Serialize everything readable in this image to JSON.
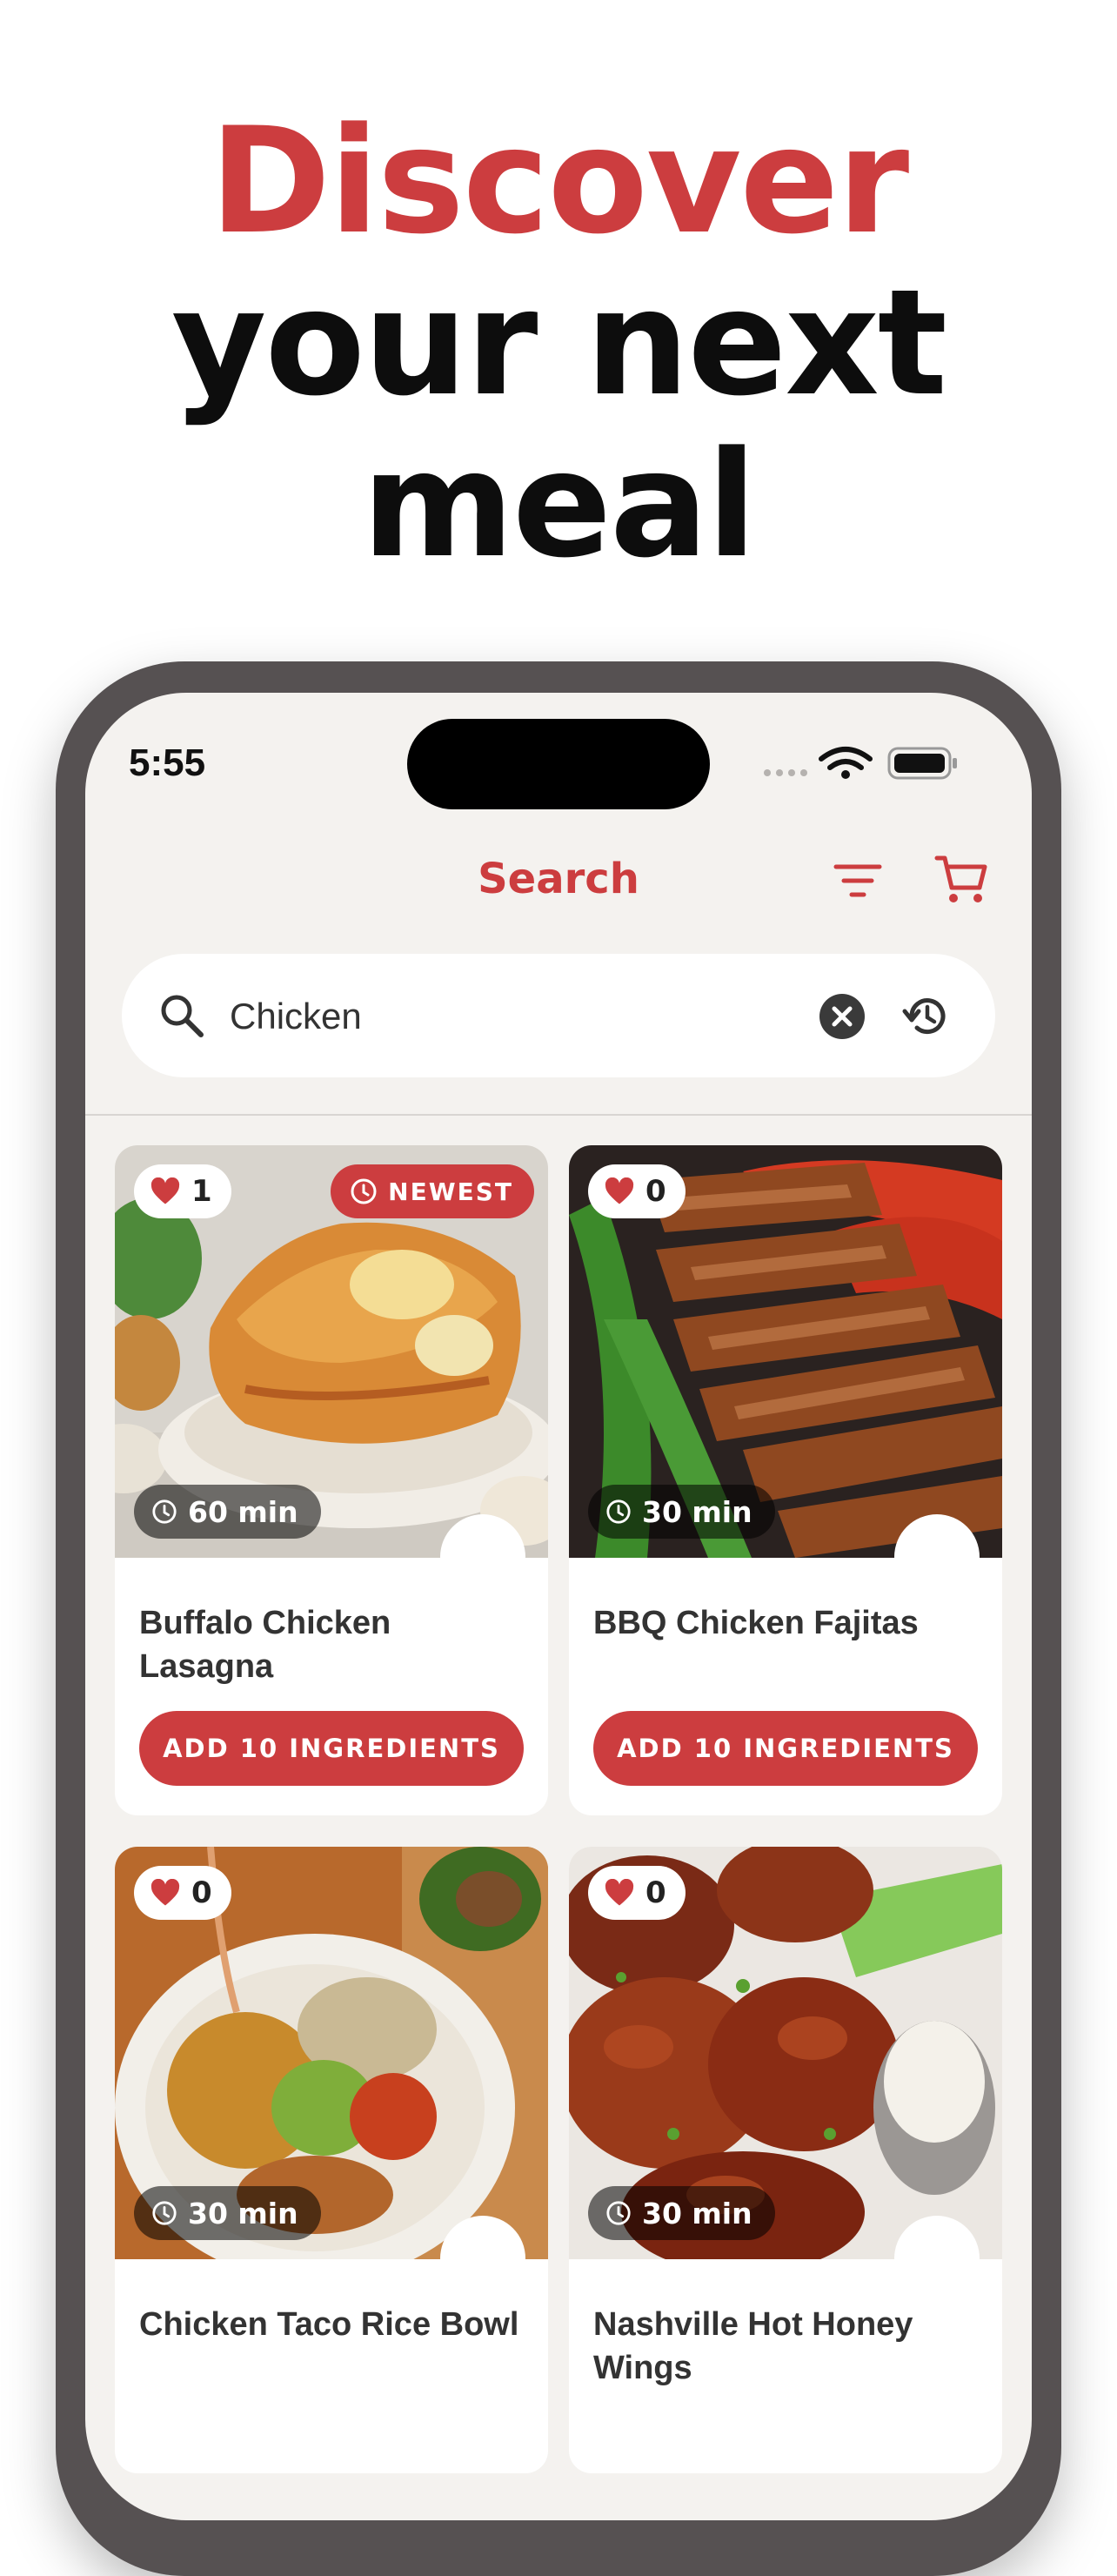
{
  "hero": {
    "line1": "Discover",
    "line2": "your next",
    "line3": "meal"
  },
  "status_bar": {
    "time": "5:55"
  },
  "nav": {
    "title": "Search"
  },
  "search": {
    "value": "Chicken"
  },
  "recipes": [
    {
      "title": "Buffalo Chicken Lasagna",
      "likes": "1",
      "time": "60 min",
      "badge": "NEWEST",
      "button": "ADD 10 INGREDIENTS"
    },
    {
      "title": "BBQ Chicken Fajitas",
      "likes": "0",
      "time": "30 min",
      "button": "ADD 10 INGREDIENTS"
    },
    {
      "title": "Chicken Taco Rice Bowl",
      "likes": "0",
      "time": "30 min"
    },
    {
      "title": "Nashville Hot Honey Wings",
      "likes": "0",
      "time": "30 min"
    }
  ],
  "colors": {
    "accent": "#cc3d3f",
    "background": "#f4f2ef",
    "frame": "#565152",
    "text_dark": "#0d0d0d"
  },
  "icons": [
    "search-icon",
    "clear-icon",
    "history-icon",
    "filter-icon",
    "cart-icon",
    "heart-icon",
    "clock-icon",
    "wifi-icon",
    "battery-icon",
    "signal-icon"
  ]
}
